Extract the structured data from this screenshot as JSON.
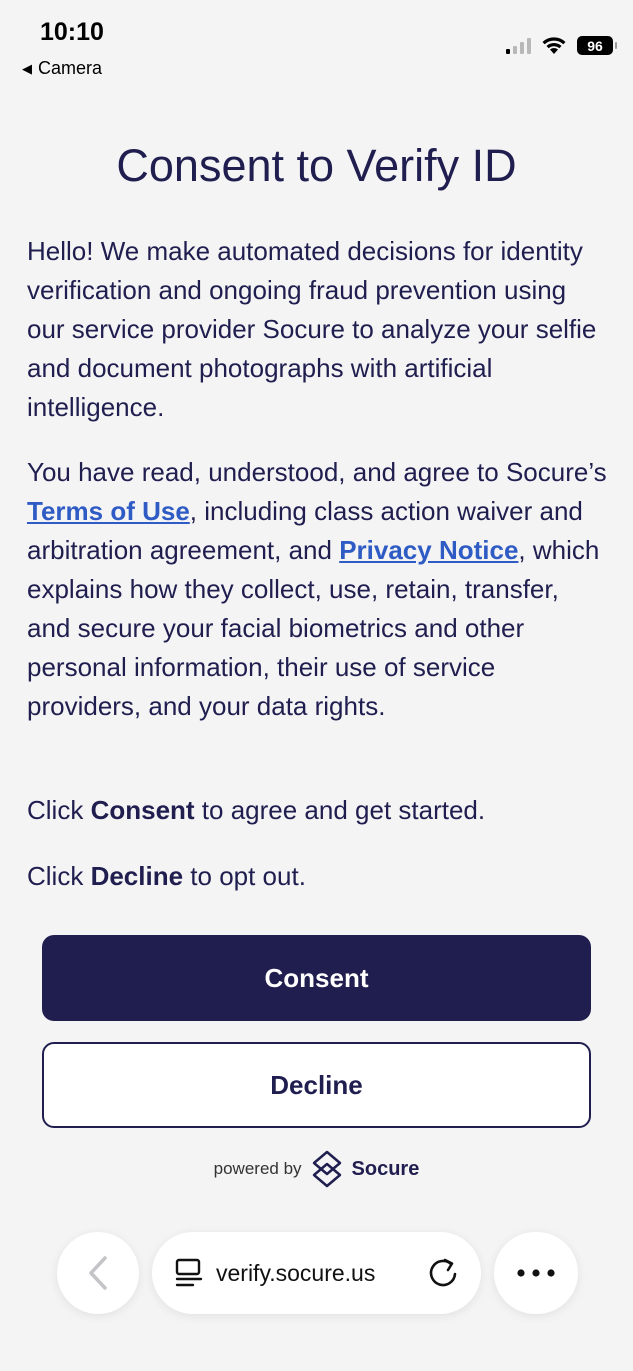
{
  "status_bar": {
    "time": "10:10",
    "back_app": "Camera",
    "battery": "96",
    "signal_bars": 4,
    "signal_active": 1
  },
  "content": {
    "title": "Consent to Verify ID",
    "p1": "Hello! We make automated decisions for identity verification and ongoing fraud prevention using our service provider Socure to analyze your selfie and document photographs with artificial intelligence.",
    "p2_before": "You have read, understood, and agree to Socure’s ",
    "terms_link": "Terms of Use",
    "p2_middle": ", including class action waiver and arbitration agreement, and ",
    "privacy_link": "Privacy Notice",
    "p2_after": ", which explains how they collect, use, retain, transfer, and secure your facial biometrics and other personal information, their use of service providers, and your data rights.",
    "p3_before": "Click ",
    "p3_bold": "Consent",
    "p3_after": " to agree and get started.",
    "p4_before": "Click ",
    "p4_bold": "Decline",
    "p4_after": " to opt out."
  },
  "buttons": {
    "consent": "Consent",
    "decline": "Decline"
  },
  "footer": {
    "powered_by": "powered by",
    "brand": "Socure"
  },
  "browser": {
    "url": "verify.socure.us"
  },
  "colors": {
    "primary": "#1f1e4f",
    "link": "#2f5cc4",
    "background": "#f4f4f5"
  },
  "icons": [
    "back-triangle-icon",
    "cellular-signal-icon",
    "wifi-icon",
    "battery-icon",
    "socure-logo-icon",
    "chevron-left-icon",
    "tabs-icon",
    "reload-icon",
    "more-icon"
  ]
}
